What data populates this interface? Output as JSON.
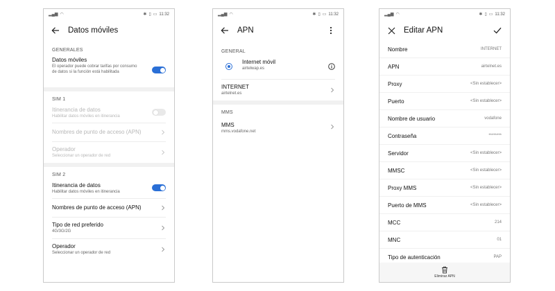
{
  "status_bar": {
    "time": "11:32"
  },
  "screen1": {
    "title": "Datos móviles",
    "generales_header": "GENERALES",
    "datos_moviles": {
      "title": "Datos móviles",
      "subtitle": "El operador puede cobrar tarifas por consumo de datos si la función está habilitada",
      "enabled": true
    },
    "sim1_header": "SIM 1",
    "sim1_roaming": {
      "title": "Itinerancia de datos",
      "subtitle": "Habilitar datos móviles en itinerancia",
      "enabled": false
    },
    "sim1_apn": {
      "title": "Nombres de punto de acceso (APN)"
    },
    "sim1_operator": {
      "title": "Operador",
      "subtitle": "Seleccionar un operador de red"
    },
    "sim2_header": "SIM 2",
    "sim2_roaming": {
      "title": "Itinerancia de datos",
      "subtitle": "Habilitar datos móviles en itinerancia",
      "enabled": true
    },
    "sim2_apn": {
      "title": "Nombres de punto de acceso (APN)"
    },
    "sim2_network": {
      "title": "Tipo de red preferido",
      "subtitle": "4G/3G/2G"
    },
    "sim2_operator": {
      "title": "Operador",
      "subtitle": "Seleccionar un operador de red"
    }
  },
  "screen2": {
    "title": "APN",
    "general_header": "GENERAL",
    "apns": [
      {
        "name": "Internet móvil",
        "apn": "airtelwap.es",
        "selected": true
      },
      {
        "name": "INTERNET",
        "apn": "airtelnet.es"
      }
    ],
    "mms_header": "MMS",
    "mms": {
      "name": "MMS",
      "apn": "mms.vodafone.net"
    }
  },
  "screen3": {
    "title": "Editar APN",
    "fields": [
      {
        "label": "Nombre",
        "value": "INTERNET"
      },
      {
        "label": "APN",
        "value": "airtelnet.es"
      },
      {
        "label": "Proxy",
        "value": "<Sin establecer>"
      },
      {
        "label": "Puerto",
        "value": "<Sin establecer>"
      },
      {
        "label": "Nombre de usuario",
        "value": "vodafone"
      },
      {
        "label": "Contraseña",
        "value": "********"
      },
      {
        "label": "Servidor",
        "value": "<Sin establecer>"
      },
      {
        "label": "MMSC",
        "value": "<Sin establecer>"
      },
      {
        "label": "Proxy MMS",
        "value": "<Sin establecer>"
      },
      {
        "label": "Puerto de MMS",
        "value": "<Sin establecer>"
      },
      {
        "label": "MCC",
        "value": "214"
      },
      {
        "label": "MNC",
        "value": "01"
      },
      {
        "label": "Tipo de autenticación",
        "value": "PAP"
      }
    ],
    "delete_label": "Eliminar APN"
  },
  "colors": {
    "accent": "#2a6fd6",
    "divider": "#ececec"
  }
}
